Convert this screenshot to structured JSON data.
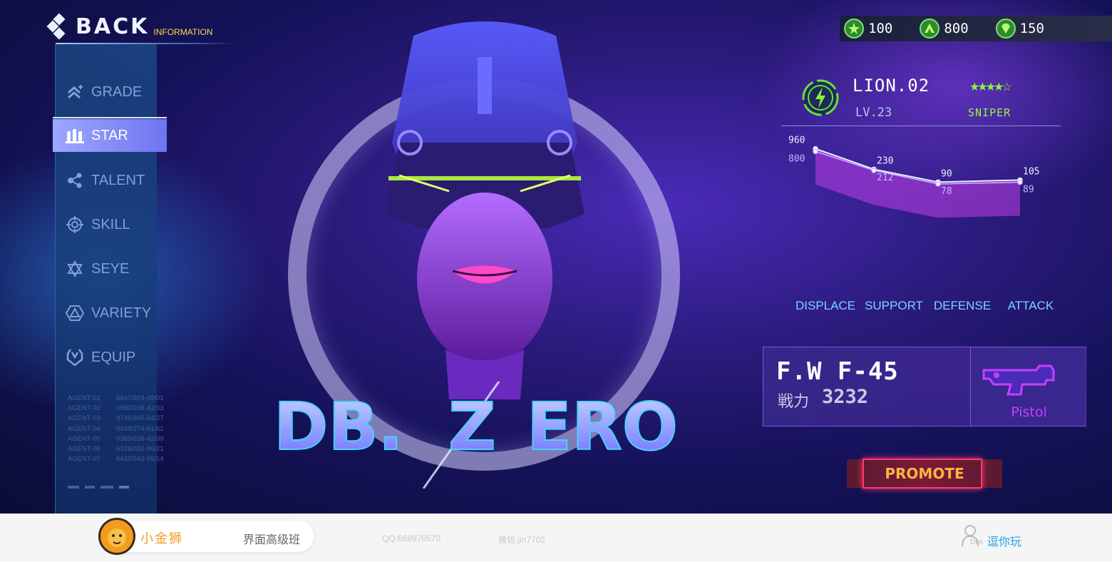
{
  "header": {
    "back_label": "BACK",
    "back_sub": "INFORMATION"
  },
  "menu": {
    "items": [
      {
        "label": "GRADE",
        "icon": "grade-icon"
      },
      {
        "label": "STAR",
        "icon": "star-bullets-icon",
        "active": true
      },
      {
        "label": "TALENT",
        "icon": "talent-share-icon"
      },
      {
        "label": "SKILL",
        "icon": "skill-target-icon"
      },
      {
        "label": "SEYE",
        "icon": "seye-star-icon"
      },
      {
        "label": "VARIETY",
        "icon": "variety-hexagon-icon"
      },
      {
        "label": "EQUIP",
        "icon": "equip-shield-icon"
      }
    ]
  },
  "agents": [
    {
      "id": "AGENT-01",
      "code": "5647/929-39/01"
    },
    {
      "id": "AGENT-02",
      "code": "0960/246-42/33"
    },
    {
      "id": "AGENT-03",
      "code": "9746/345-54/27"
    },
    {
      "id": "AGENT-04",
      "code": "0049/274-61/61"
    },
    {
      "id": "AGENT-05",
      "code": "0383/626-42/39"
    },
    {
      "id": "AGENT-06",
      "code": "6328/032-86/21"
    },
    {
      "id": "AGENT-07",
      "code": "6432/542-65/14"
    }
  ],
  "hero_title": {
    "part1": "DB.",
    "part2": "Z",
    "part3": "ERO"
  },
  "currency": [
    {
      "icon": "star-coin-icon",
      "value": "100"
    },
    {
      "icon": "rank-coin-icon",
      "value": "800"
    },
    {
      "icon": "diamond-icon",
      "value": "150"
    }
  ],
  "character": {
    "name": "LION.02",
    "level": "LV.23",
    "stars": "★★★★☆",
    "rating": 4.5,
    "class": "SNIPER",
    "icon": "lightning-badge-icon"
  },
  "chart_data": {
    "type": "line",
    "categories": [
      "DISPLACE",
      "SUPPORT",
      "DEFENSE",
      "ATTACK"
    ],
    "series": [
      {
        "values": [
          960,
          230,
          90,
          105
        ]
      },
      {
        "values": [
          800,
          212,
          78,
          89
        ]
      }
    ],
    "colors": {
      "upper": "#e6f0ff",
      "lower": "#c8b6ff",
      "fill": "#c040e8",
      "labels": "#7ad4ff"
    }
  },
  "weapon": {
    "name": "F.W F-45",
    "power_label": "戦力",
    "power": "3232",
    "type": "Pistol",
    "icon": "pistol-icon"
  },
  "promote": {
    "label": "PROMOTE"
  },
  "footer": {
    "brand_name": "小金狮",
    "brand_course": "界面高级班",
    "qq": "QQ:669970570",
    "wechat": "微信:jin7702",
    "des_label": "Des",
    "play_link": "逗你玩"
  }
}
